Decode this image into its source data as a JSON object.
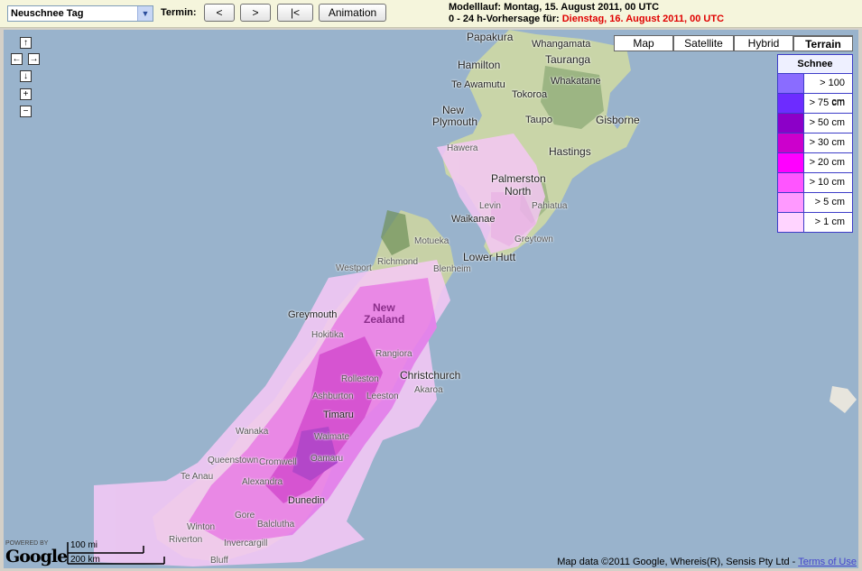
{
  "toolbar": {
    "product_select": "Neuschnee Tag",
    "termin_label": "Termin:",
    "prev_label": "<",
    "next_label": ">",
    "first_label": "|<",
    "animation_label": "Animation",
    "run_line_prefix": "Modelllauf: Montag, 15. August 2011, 00 UTC",
    "forecast_prefix": "0 - 24 h-Vorhersage für: ",
    "forecast_date": "Dienstag, 16. August 2011, 00 UTC"
  },
  "map_controls": {
    "pan_up": "↑",
    "pan_left": "←",
    "pan_right": "→",
    "pan_down": "↓",
    "zoom_in": "+",
    "zoom_out": "−"
  },
  "map_types": {
    "map": "Map",
    "satellite": "Satellite",
    "hybrid": "Hybrid",
    "terrain": "Terrain",
    "selected": "Terrain"
  },
  "legend": {
    "title": "Schnee",
    "items": [
      {
        "label": "> 100 cm",
        "color": "#8a6cff"
      },
      {
        "label": "> 75 cm",
        "color": "#6d2cff"
      },
      {
        "label": "> 50 cm",
        "color": "#8c00c8"
      },
      {
        "label": "> 30 cm",
        "color": "#cc00cc"
      },
      {
        "label": "> 20 cm",
        "color": "#ff00ff"
      },
      {
        "label": "> 10 cm",
        "color": "#ff55ff"
      },
      {
        "label": "> 5 cm",
        "color": "#ff99ff"
      },
      {
        "label": "> 1 cm",
        "color": "#ffd4ff"
      }
    ]
  },
  "places": {
    "papakura": "Papakura",
    "whangamata": "Whangamata",
    "hamilton": "Hamilton",
    "tauranga": "Tauranga",
    "te_awamutu": "Te Awamutu",
    "whakatane": "Whakatane",
    "tokoroa": "Tokoroa",
    "new_plymouth_1": "New",
    "new_plymouth_2": "Plymouth",
    "taupo": "Taupo",
    "gisborne": "Gisborne",
    "hawera": "Hawera",
    "hastings": "Hastings",
    "palmerston_1": "Palmerston",
    "palmerston_2": "North",
    "levin": "Levin",
    "pahiatua": "Pahiatua",
    "waikanae": "Waikanae",
    "greytown": "Greytown",
    "motueka": "Motueka",
    "lower_hutt": "Lower Hutt",
    "richmond": "Richmond",
    "westport": "Westport",
    "blenheim": "Blenheim",
    "greymouth": "Greymouth",
    "nz_1": "New",
    "nz_2": "Zealand",
    "hokitika": "Hokitika",
    "rangiora": "Rangiora",
    "christchurch": "Christchurch",
    "rolleston": "Rolleston",
    "akaroa": "Akaroa",
    "ashburton": "Ashburton",
    "leeston": "Leeston",
    "timaru": "Timaru",
    "wanaka": "Wanaka",
    "waimate": "Waimate",
    "queenstown": "Queenstown",
    "cromwell": "Cromwell",
    "oamaru": "Oamaru",
    "te_anau": "Te Anau",
    "alexandra": "Alexandra",
    "dunedin": "Dunedin",
    "gore": "Gore",
    "balclutha": "Balclutha",
    "winton": "Winton",
    "riverton": "Riverton",
    "invercargill": "Invercargill",
    "bluff": "Bluff"
  },
  "footer": {
    "powered_by": "POWERED BY",
    "google": "Google",
    "scale_mi": "100 mi",
    "scale_km": "200 km",
    "map_data": "Map data ©2011 Google, Whereis(R), Sensis Pty Ltd - ",
    "terms": "Terms of Use"
  }
}
